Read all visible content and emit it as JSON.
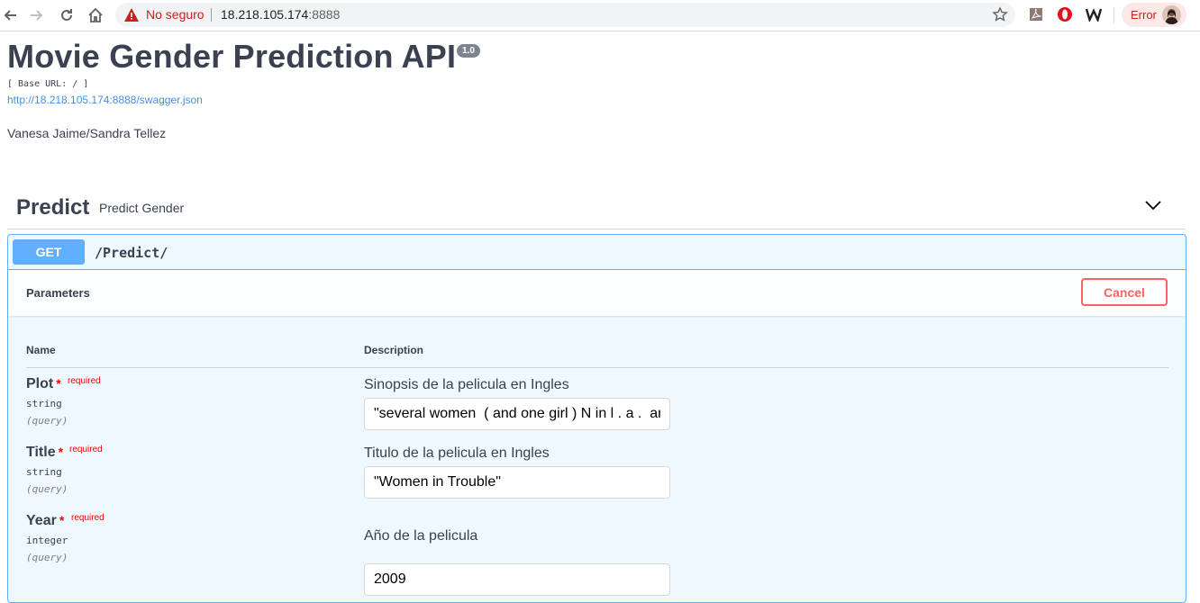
{
  "browser": {
    "security_label": "No seguro",
    "url_host": "18.218.105.174",
    "url_port": ":8888",
    "profile_status": "Error"
  },
  "info": {
    "title": "Movie Gender Prediction API",
    "version": "1.0",
    "base_url": "[ Base URL: / ]",
    "spec_link": "http://18.218.105.174:8888/swagger.json",
    "authors": "Vanesa Jaime/Sandra Tellez"
  },
  "tag": {
    "name": "Predict",
    "description": "Predict Gender"
  },
  "operation": {
    "method": "GET",
    "path": "/Predict/",
    "parameters_title": "Parameters",
    "cancel_label": "Cancel",
    "columns": {
      "name": "Name",
      "description": "Description"
    },
    "params": [
      {
        "name": "Plot",
        "required_label": "required",
        "type": "string",
        "in": "(query)",
        "description": "Sinopsis de la pelicula en Ingles",
        "value": "\"several women  ( and one girl ) N in l . a .  ar"
      },
      {
        "name": "Title",
        "required_label": "required",
        "type": "string",
        "in": "(query)",
        "description": "Titulo de la pelicula en Ingles",
        "value": "\"Women in Trouble\""
      },
      {
        "name": "Year",
        "required_label": "required",
        "type": "integer",
        "in": "(query)",
        "description": "Año de la pelicula",
        "value": "2009"
      }
    ]
  },
  "colors": {
    "get_method": "#61affe",
    "cancel": "#ff6060",
    "required": "#ff0000",
    "link": "#4990e2"
  },
  "icons": [
    "back-arrow-icon",
    "forward-arrow-icon",
    "reload-icon",
    "home-icon",
    "warning-icon",
    "star-icon",
    "pdf-extension-icon",
    "opera-extension-icon",
    "w-extension-icon",
    "avatar",
    "chevron-down-icon"
  ]
}
